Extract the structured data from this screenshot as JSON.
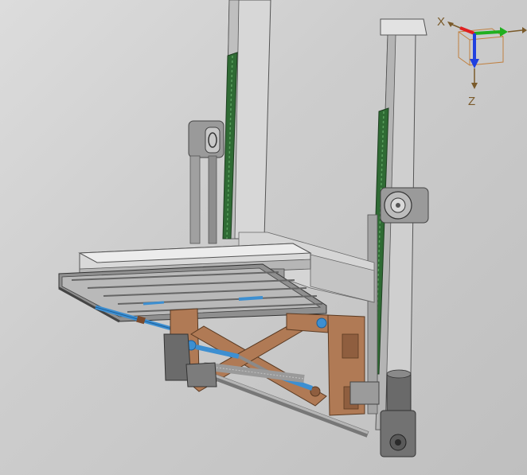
{
  "viewport": {
    "background_top": "#dcdcdc",
    "background_bottom": "#bfbfbf"
  },
  "axis_triad": {
    "x_label": "X",
    "z_label": "Z",
    "x_color": "#e02020",
    "y_color": "#20b020",
    "z_color": "#2040e0",
    "cube_color": "#c08040"
  },
  "model": {
    "frame_color": "#a9a9a9",
    "rail_color": "#2f6b34",
    "bronze_color": "#b07a55",
    "actuator_color": "#3d8fd1",
    "dark_color": "#6b6b6b"
  }
}
